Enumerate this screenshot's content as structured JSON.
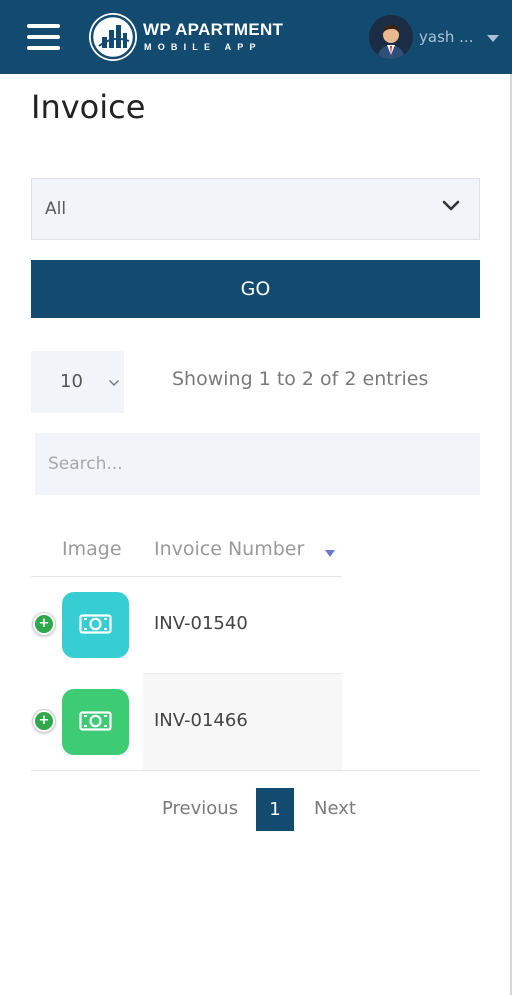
{
  "header": {
    "app_title": "WP APARTMENT",
    "app_subtitle": "MOBILE APP",
    "user_name": "yash ...",
    "colors": {
      "bar": "#134a70"
    }
  },
  "page": {
    "title": "Invoice"
  },
  "filter": {
    "selected": "All",
    "go_label": "GO"
  },
  "table_controls": {
    "page_length": "10",
    "info": "Showing 1 to 2 of 2 entries",
    "search_placeholder": "Search..."
  },
  "table": {
    "columns": [
      "Image",
      "Invoice Number"
    ],
    "rows": [
      {
        "invoice_number": "INV-01540",
        "icon": "money-bill-icon",
        "color": "#36cdd3"
      },
      {
        "invoice_number": "INV-01466",
        "icon": "money-bill-icon",
        "color": "#3dcb74"
      }
    ]
  },
  "pagination": {
    "previous": "Previous",
    "current": "1",
    "next": "Next"
  }
}
